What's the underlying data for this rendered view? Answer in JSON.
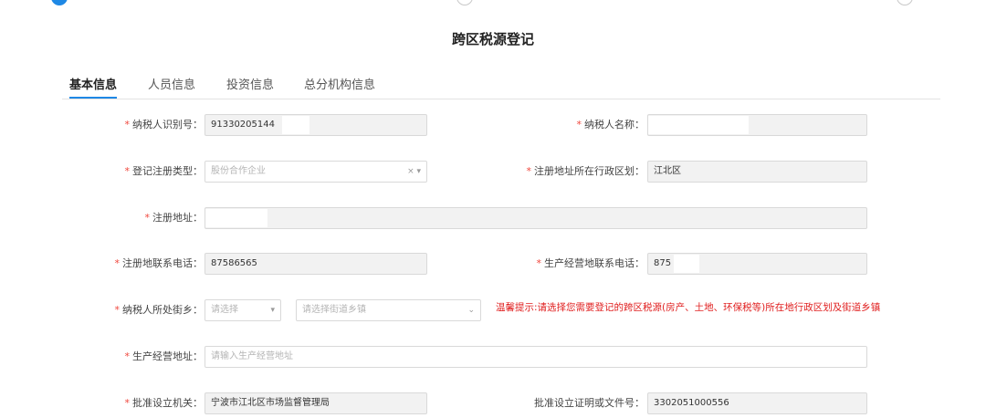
{
  "page_title": "跨区税源登记",
  "tabs": [
    {
      "label": "基本信息",
      "active": true
    },
    {
      "label": "人员信息",
      "active": false
    },
    {
      "label": "投资信息",
      "active": false
    },
    {
      "label": "总分机构信息",
      "active": false
    }
  ],
  "form": {
    "taxpayer_id": {
      "label": "纳税人识别号：",
      "value": "91330205144"
    },
    "taxpayer_name": {
      "label": "纳税人名称：",
      "value": ""
    },
    "registration_type": {
      "label": "登记注册类型：",
      "value": "股份合作企业"
    },
    "district": {
      "label": "注册地址所在行政区划：",
      "value": "江北区"
    },
    "address": {
      "label": "注册地址：",
      "value": ""
    },
    "reg_phone": {
      "label": "注册地联系电话：",
      "value": "87586565"
    },
    "biz_phone": {
      "label": "生产经营地联系电话：",
      "value": "875"
    },
    "street": {
      "label": "纳税人所处街乡：",
      "placeholder": "请选择",
      "sub_placeholder": "请选择街道乡镇"
    },
    "hint": "温馨提示:请选择您需要登记的跨区税源(房产、土地、环保税等)所在地行政区划及街道乡镇",
    "biz_address": {
      "label": "生产经营地址：",
      "placeholder": "请输入生产经营地址"
    },
    "approval_org": {
      "label": "批准设立机关：",
      "value": "宁波市江北区市场监督管理局"
    },
    "approval_doc": {
      "label": "批准设立证明或文件号：",
      "value": "3302051000556"
    }
  },
  "colors": {
    "accent": "#1e88e5",
    "required": "#f0463c",
    "hint": "#e02020"
  }
}
